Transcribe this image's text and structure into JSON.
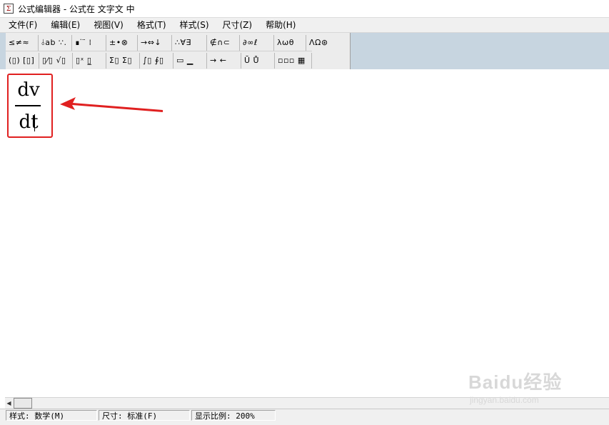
{
  "window": {
    "title": "公式编辑器 - 公式在 文字文 中",
    "icon": "formula-editor-icon"
  },
  "menu": [
    {
      "label": "文件(F)"
    },
    {
      "label": "编辑(E)"
    },
    {
      "label": "视图(V)"
    },
    {
      "label": "格式(T)"
    },
    {
      "label": "样式(S)"
    },
    {
      "label": "尺寸(Z)"
    },
    {
      "label": "帮助(H)"
    }
  ],
  "toolbar": {
    "row1": [
      {
        "glyph": "≤≠≈",
        "name": "relational-symbols"
      },
      {
        "glyph": "⫰ab ∵.",
        "name": "spaces-ellipses"
      },
      {
        "glyph": "∎ ̇ ̈ ⁞",
        "name": "embellishments"
      },
      {
        "glyph": "±•⊗",
        "name": "operator-symbols"
      },
      {
        "glyph": "→⇔↓",
        "name": "arrow-symbols"
      },
      {
        "glyph": "∴∀∃",
        "name": "logical-symbols"
      },
      {
        "glyph": "∉∩⊂",
        "name": "set-theory-symbols"
      },
      {
        "glyph": "∂∞ℓ",
        "name": "misc-symbols"
      },
      {
        "glyph": "λωθ",
        "name": "greek-lowercase"
      },
      {
        "glyph": "ΛΩ⊛",
        "name": "greek-uppercase"
      }
    ],
    "row2": [
      {
        "glyph": "(▯) [▯]",
        "name": "fence-templates"
      },
      {
        "glyph": "▯⁄▯ √▯",
        "name": "fraction-radical-templates"
      },
      {
        "glyph": "▯ˣ ▯̲",
        "name": "subscript-superscript-templates"
      },
      {
        "glyph": "Σ▯ Σ▯",
        "name": "summation-templates"
      },
      {
        "glyph": "∫▯ ∮▯",
        "name": "integral-templates"
      },
      {
        "glyph": "▭ ▁",
        "name": "underbar-overbar-templates"
      },
      {
        "glyph": "→ ←",
        "name": "labeled-arrow-templates"
      },
      {
        "glyph": "Ū Ů",
        "name": "products-set-templates"
      },
      {
        "glyph": "▫▫▫ ▦",
        "name": "matrix-templates"
      }
    ]
  },
  "equation": {
    "numerator": "dv",
    "denominator": "dt"
  },
  "annotation": {
    "box_color": "#e02020",
    "arrow_color": "#e02020"
  },
  "statusbar": {
    "style": "样式: 数学(M)",
    "size": "尺寸: 标准(F)",
    "zoom": "显示比例: 200%"
  },
  "watermark": {
    "logo": "Baidu经验",
    "url": "jingyan.baidu.com"
  }
}
